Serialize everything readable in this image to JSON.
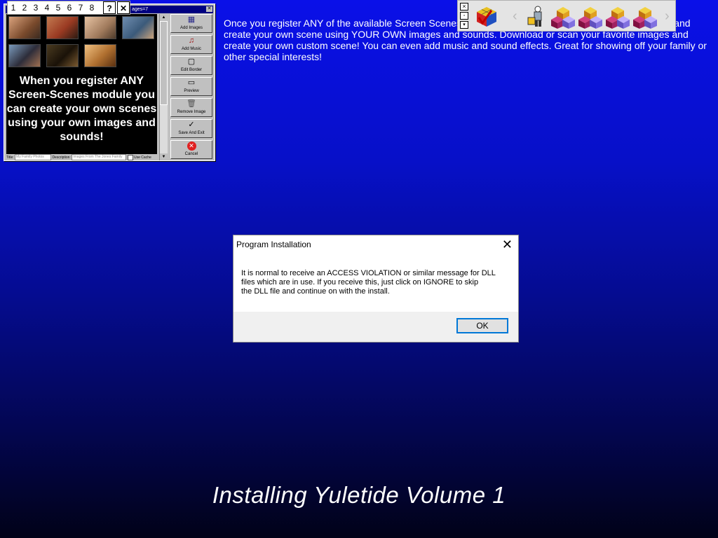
{
  "promo_text": "Once you register ANY of the available Screen Scenes modules you can ADD YOUR OWN PICTURES and create your own scene using YOUR OWN images and sounds. Download or scan your favorite images and create your own custom scene! You can even add music and sound effects. Great for showing off your family or other special interests!",
  "install_title": "Installing Yuletide Volume 1",
  "editor": {
    "title_fragment": "ages=7",
    "overlay_text": "When you register ANY Screen-Scenes module you can create your own scenes using your own images and sounds!",
    "buttons": [
      {
        "label": "Add Images",
        "icon": "grid-icon"
      },
      {
        "label": "Add Music",
        "icon": "music-icon"
      },
      {
        "label": "Edit Border",
        "icon": "border-icon"
      },
      {
        "label": "Preview",
        "icon": "monitor-icon"
      },
      {
        "label": "Remove Image",
        "icon": "trash-icon"
      },
      {
        "label": "Save And Exit",
        "icon": "check-icon"
      },
      {
        "label": "Cancel",
        "icon": "cancel-icon"
      }
    ],
    "title_label": "Title:",
    "title_value": "My Family Photos",
    "description_label": "Description:",
    "description_value": "Images From The Jones Family",
    "use_cache_label": "Use Cache"
  },
  "number_bar": [
    "1",
    "2",
    "3",
    "4",
    "5",
    "6",
    "7",
    "8"
  ],
  "number_bar_help": "?",
  "number_bar_close": "✕",
  "dialog": {
    "title": "Program Installation",
    "message": "It is normal to receive an ACCESS VIOLATION or similar message for DLL\nfiles which are in use.  If you receive this, just click on IGNORE to skip\nthe DLL file and continue on with the install.",
    "ok_label": "OK"
  }
}
